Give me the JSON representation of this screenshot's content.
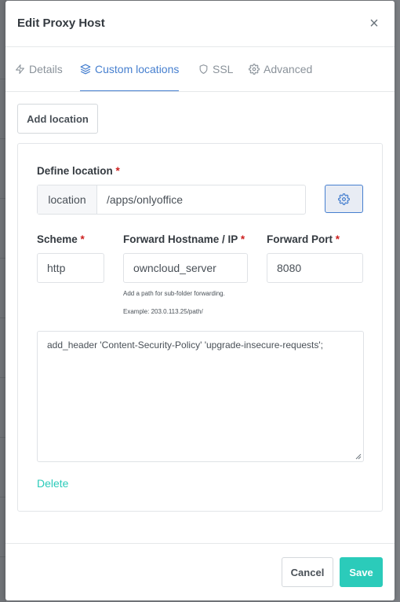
{
  "modal": {
    "title": "Edit Proxy Host",
    "close_label": "×"
  },
  "tabs": [
    {
      "label": "Details",
      "icon": "bolt-icon",
      "active": false
    },
    {
      "label": "Custom locations",
      "icon": "layers-icon",
      "active": true
    },
    {
      "label": "SSL",
      "icon": "shield-icon",
      "active": false
    },
    {
      "label": "Advanced",
      "icon": "gear-icon",
      "active": false
    }
  ],
  "add_location_label": "Add location",
  "location": {
    "define_label": "Define location",
    "addon": "location",
    "value": "/apps/onlyoffice",
    "scheme_label": "Scheme",
    "scheme_value": "http",
    "hostname_label": "Forward Hostname / IP",
    "hostname_value": "owncloud_server",
    "port_label": "Forward Port",
    "port_value": "8080",
    "hint_line1": "Add a path for sub-folder forwarding.",
    "hint_line2": "Example: 203.0.113.25/path/",
    "advanced_config": "add_header 'Content-Security-Policy' 'upgrade-insecure-requests';",
    "delete_label": "Delete",
    "required_mark": "*"
  },
  "footer": {
    "cancel_label": "Cancel",
    "save_label": "Save"
  },
  "colors": {
    "accent": "#467fcf",
    "teal": "#2bcbba",
    "required": "#cd201f"
  }
}
